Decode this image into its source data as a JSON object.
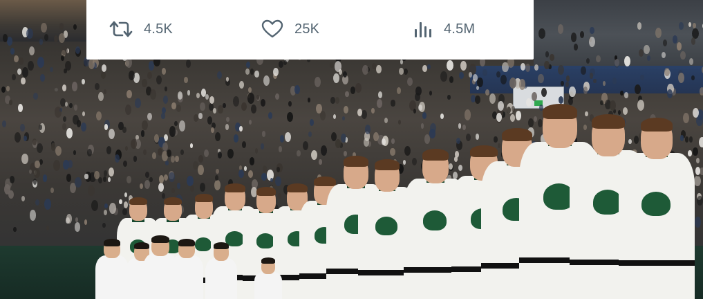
{
  "tweet": {
    "retweets": "4.5K",
    "likes": "25K",
    "views": "4.5M"
  },
  "icons": {
    "retweet": "retweet-icon",
    "like": "heart-icon",
    "views": "bar-chart-icon"
  },
  "colors": {
    "stat_text": "#536471",
    "card_background": "#ffffff",
    "jersey_trim": "#1e5a37"
  }
}
